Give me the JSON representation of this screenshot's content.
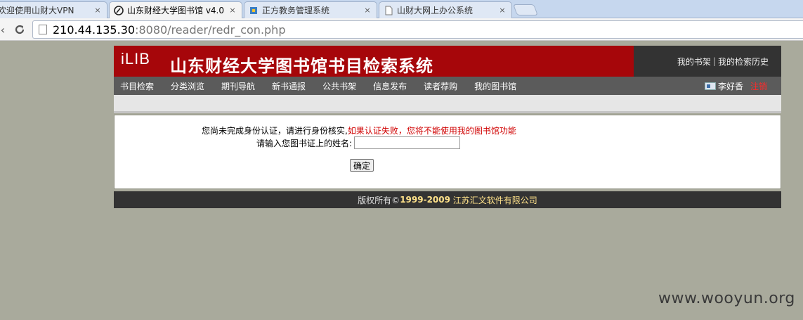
{
  "browser": {
    "tabs": [
      {
        "title": "欢迎使用山财大VPN",
        "active": false
      },
      {
        "title": "山东财经大学图书馆 v4.0",
        "active": true
      },
      {
        "title": "正方教务管理系统",
        "active": false
      },
      {
        "title": "山财大网上办公系统",
        "active": false
      }
    ],
    "close_glyph": "×",
    "url_host": "210.44.135.30",
    "url_rest": ":8080/reader/redr_con.php"
  },
  "header": {
    "logo_text": "iLIB",
    "title": "山东财经大学图书馆书目检索系统",
    "links": {
      "bookshelf": "我的书架",
      "separator": "|",
      "history": "我的检索历史"
    }
  },
  "nav": {
    "items": [
      "书目检索",
      "分类浏览",
      "期刊导航",
      "新书通报",
      "公共书架",
      "信息发布",
      "读者荐购",
      "我的图书馆"
    ],
    "user_name": "李好香",
    "logout": "注销"
  },
  "content": {
    "notice": "您尚未完成身份认证，请进行身份核实,",
    "warning": "如果认证失败，您将不能使用我的图书馆功能",
    "name_label": "请输入您图书证上的姓名:",
    "name_value": "",
    "submit_label": "确定"
  },
  "footer": {
    "prefix": "版权所有©",
    "years": "1999-2009",
    "company": "江苏汇文软件有限公司"
  },
  "watermark": "www.wooyun.org",
  "colors": {
    "header_red": "#a6060a",
    "nav_gray": "#5b5b5b",
    "footer_dark": "#333333",
    "warning_red": "#d00000"
  }
}
